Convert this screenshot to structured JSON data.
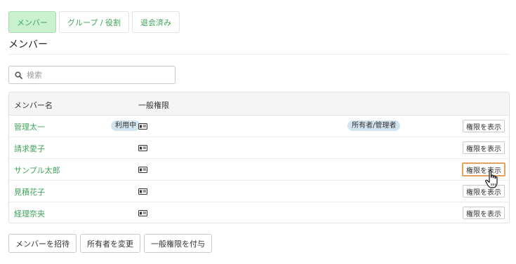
{
  "tabs": [
    {
      "label": "メンバー",
      "active": true
    },
    {
      "label": "グループ / 役割",
      "active": false
    },
    {
      "label": "退会済み",
      "active": false
    }
  ],
  "page_title": "メンバー",
  "search": {
    "placeholder": "検索",
    "value": ""
  },
  "table": {
    "headers": {
      "name": "メンバー名",
      "general_permissions": "一般権限"
    },
    "rows": [
      {
        "name": "管理太一",
        "status": "利用中",
        "role": "所有者/管理者",
        "action": "権限を表示"
      },
      {
        "name": "請求愛子",
        "status": "",
        "role": "",
        "action": "権限を表示"
      },
      {
        "name": "サンプル太郎",
        "status": "",
        "role": "",
        "action": "権限を表示"
      },
      {
        "name": "見積花子",
        "status": "",
        "role": "",
        "action": "権限を表示"
      },
      {
        "name": "経理奈央",
        "status": "",
        "role": "",
        "action": "権限を表示"
      }
    ]
  },
  "actions": {
    "invite": "メンバーを招待",
    "change_owner": "所有者を変更",
    "grant": "一般権限を付与"
  },
  "colors": {
    "accent": "#3fa55a",
    "active_tab_bg": "#c9f0cf",
    "badge_bg": "#d4e4ee",
    "focus_outline": "#e4a15c"
  },
  "icons": {
    "search": "search-icon",
    "id_card": "id-card-icon",
    "cursor": "hand-pointer-icon"
  }
}
